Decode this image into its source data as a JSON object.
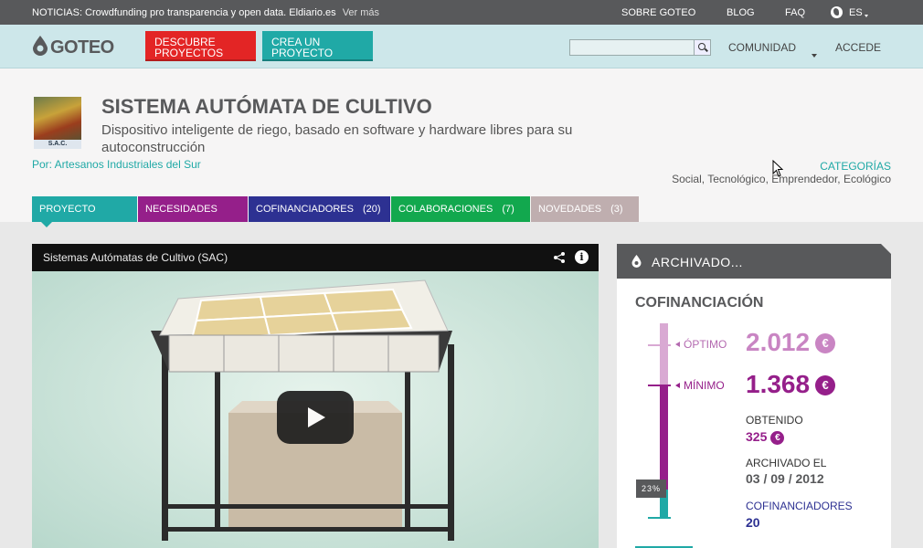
{
  "topbar": {
    "news": "NOTICIAS: Crowdfunding pro transparencia y open data. Eldiario.es",
    "more": "Ver más",
    "links": [
      "SOBRE GOTEO",
      "BLOG",
      "FAQ"
    ],
    "lang": "ES"
  },
  "header": {
    "logo": "GOTEO",
    "btn_descubre": "DESCUBRE PROYECTOS",
    "btn_crea": "CREA UN PROYECTO",
    "search_placeholder": "",
    "comunidad": "COMUNIDAD",
    "accede": "ACCEDE"
  },
  "project": {
    "image_label": "S.A.C.",
    "title": "SISTEMA AUTÓMATA DE CULTIVO",
    "subtitle": "Dispositivo inteligente de riego, basado en software y hardware libres para su autoconstrucción",
    "author": "Por: Artesanos Industriales del Sur",
    "categories_label": "CATEGORÍAS",
    "categories": "Social, Tecnológico, Emprendedor, Ecológico"
  },
  "tabs": {
    "proyecto": "PROYECTO",
    "necesidades": "NECESIDADES",
    "cofinanciadores": "COFINANCIADORES",
    "cofinanciadores_count": "(20)",
    "colaboraciones": "COLABORACIONES",
    "colaboraciones_count": "(7)",
    "novedades": "NOVEDADES",
    "novedades_count": "(3)"
  },
  "video": {
    "title": "Sistemas Autómatas de Cultivo (SAC)",
    "info": "i"
  },
  "sidebar": {
    "status": "ARCHIVADO...",
    "section": "COFINANCIACIÓN",
    "optimo_label": "ÓPTIMO",
    "optimo_amount": "2.012",
    "minimo_label": "MÍNIMO",
    "minimo_amount": "1.368",
    "currency": "€",
    "percent": "23%",
    "obtenido_label": "OBTENIDO",
    "obtenido_amount": "325",
    "archivado_label": "ARCHIVADO EL",
    "archivado_date": "03 / 09 / 2012",
    "cofinanciadores_label": "COFINANCIADORES",
    "cofinanciadores_count": "20"
  },
  "colors": {
    "teal": "#20a9a6",
    "purple": "#951f8a",
    "red": "#e32525",
    "navy": "#2d3192",
    "green": "#12a84e"
  }
}
